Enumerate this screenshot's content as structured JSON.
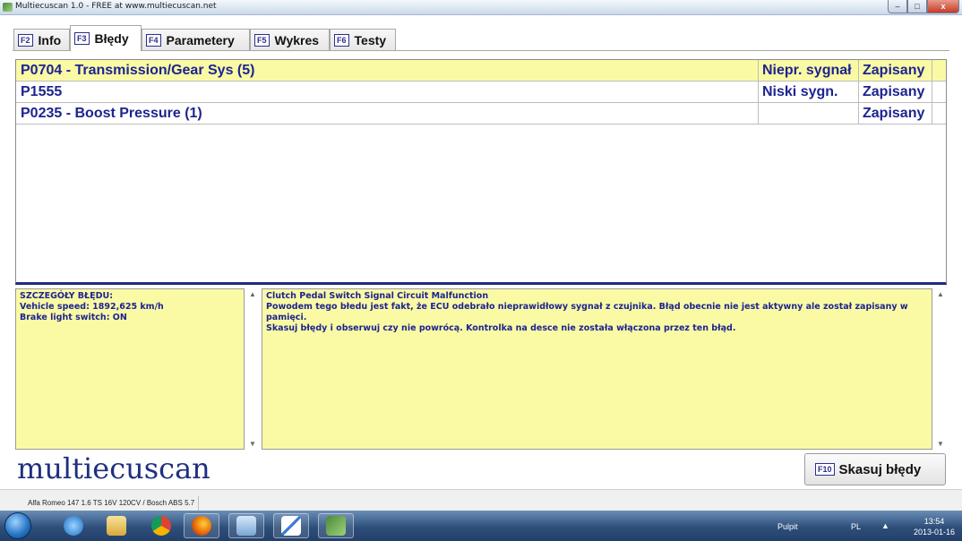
{
  "window": {
    "title": "Multiecuscan 1.0 - FREE at www.multiecuscan.net",
    "min_glyph": "–",
    "max_glyph": "□",
    "close_glyph": "x"
  },
  "tabs": [
    {
      "key": "F2",
      "label": "Info",
      "active": false
    },
    {
      "key": "F3",
      "label": "Błędy",
      "active": true
    },
    {
      "key": "F4",
      "label": "Parametery",
      "active": false
    },
    {
      "key": "F5",
      "label": "Wykres",
      "active": false
    },
    {
      "key": "F6",
      "label": "Testy",
      "active": false
    }
  ],
  "errors": [
    {
      "code": "P0704 - Transmission/Gear Sys (5)",
      "signal": "Niepr. sygnał",
      "status": "Zapisany",
      "selected": true
    },
    {
      "code": "P1555",
      "signal": "Niski sygn.",
      "status": "Zapisany",
      "selected": false
    },
    {
      "code": "P0235 - Boost Pressure (1)",
      "signal": "",
      "status": "Zapisany",
      "selected": false
    }
  ],
  "details": {
    "heading": "SZCZEGÓŁY BŁĘDU:",
    "lines": [
      "Vehicle speed: 1892,625 km/h",
      "Brake light switch: ON"
    ]
  },
  "description": {
    "title": "Clutch Pedal Switch Signal Circuit Malfunction",
    "line1": "Powodem tego błedu jest fakt, że ECU odebrało nieprawidłowy sygnał z czujnika. Błąd obecnie nie jest aktywny ale został zapisany w pamięci.",
    "line2": "Skasuj błędy i obserwuj czy nie powrócą. Kontrolka na desce nie została włączona przez ten błąd."
  },
  "logo": "multiecuscan",
  "clear_button": {
    "key": "F10",
    "label": "Skasuj błędy"
  },
  "status_bar": {
    "vehicle": "Alfa Romeo 147 1.6 TS 16V 120CV / Bosch ABS 5.7"
  },
  "taskbar": {
    "pulpit": "Pulpit",
    "lang": "PL",
    "time": "13:54",
    "date": "2013-01-16",
    "items": [
      "start-orb",
      "internet-explorer-icon",
      "file-explorer-icon",
      "chrome-icon",
      "firefox-icon",
      "control-panel-icon",
      "paint-icon",
      "multiecuscan-icon"
    ]
  },
  "colors": {
    "selected_row": "#fafaa5",
    "error_text": "#1c2490",
    "logo": "#1f2f80"
  }
}
